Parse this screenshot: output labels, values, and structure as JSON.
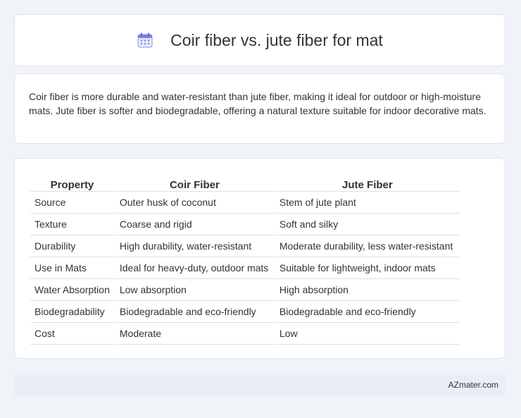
{
  "header": {
    "title": "Coir fiber vs. jute fiber for mat",
    "icon": "calendar-icon"
  },
  "summary": {
    "text": "Coir fiber is more durable and water-resistant than jute fiber, making it ideal for outdoor or high-moisture mats. Jute fiber is softer and biodegradable, offering a natural texture suitable for indoor decorative mats."
  },
  "table": {
    "headers": [
      "Property",
      "Coir Fiber",
      "Jute Fiber"
    ],
    "rows": [
      [
        "Source",
        "Outer husk of coconut",
        "Stem of jute plant"
      ],
      [
        "Texture",
        "Coarse and rigid",
        "Soft and silky"
      ],
      [
        "Durability",
        "High durability, water-resistant",
        "Moderate durability, less water-resistant"
      ],
      [
        "Use in Mats",
        "Ideal for heavy-duty, outdoor mats",
        "Suitable for lightweight, indoor mats"
      ],
      [
        "Water Absorption",
        "Low absorption",
        "High absorption"
      ],
      [
        "Biodegradability",
        "Biodegradable and eco-friendly",
        "Biodegradable and eco-friendly"
      ],
      [
        "Cost",
        "Moderate",
        "Low"
      ]
    ]
  },
  "footer": {
    "site": "AZmater.com"
  },
  "colors": {
    "background": "#f0f3f8",
    "card": "#ffffff",
    "footer_bar": "#e8edf6",
    "icon_accent": "#7b7fe0"
  }
}
